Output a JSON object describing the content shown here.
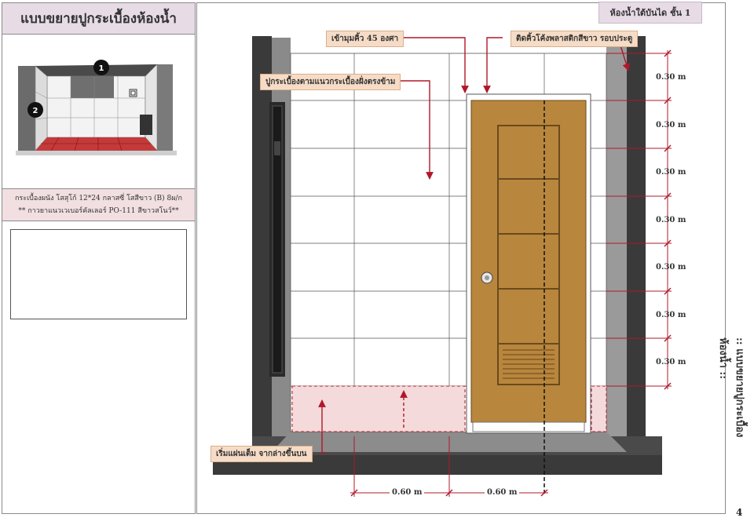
{
  "left_panel": {
    "title": "แบบขยายปูกระเบื้องห้องน้ำ",
    "markers": [
      "1",
      "2"
    ],
    "spec_line1": "กระเบื้องผนัง โสสุโก้ 12*24 กลาสซี่ โสสีขาว (B) 8ผ/ก",
    "spec_line2": "** กาวยาแนวเวเบอร์คัลเลอร์ PO-111 สีขาวสโนว์**"
  },
  "drawing": {
    "floor_label": "ห้องน้ำใต้บันได ชั้น 1",
    "callout_45deg": "เข้ามุมคิ้ว 45 องศา",
    "callout_pvc_trim": "ติดคิ้วโค้งพลาสติกสีขาว รอบประตู",
    "callout_align": "ปูกระเบื้องตามแนวกระเบื้องฝั่งตรงข้าม",
    "callout_start": "เริ่มแผ่นเต็ม จากล่างขึ้นบน",
    "row_dims": [
      "0.30 m",
      "0.30 m",
      "0.30 m",
      "0.30 m",
      "0.30 m",
      "0.30 m",
      "0.30 m"
    ],
    "col_dims": [
      "0.60 m",
      "0.60 m"
    ],
    "colors": {
      "wall_dark": "#3a3a3a",
      "door_wood": "#b8863d",
      "arrow_red": "#b0182a",
      "tile_line": "#555555",
      "hatch": "#f4dada"
    }
  },
  "side_title": ":: แบบขยายปูกระเบื้องห้องน้ำ ::",
  "page_number": "4"
}
